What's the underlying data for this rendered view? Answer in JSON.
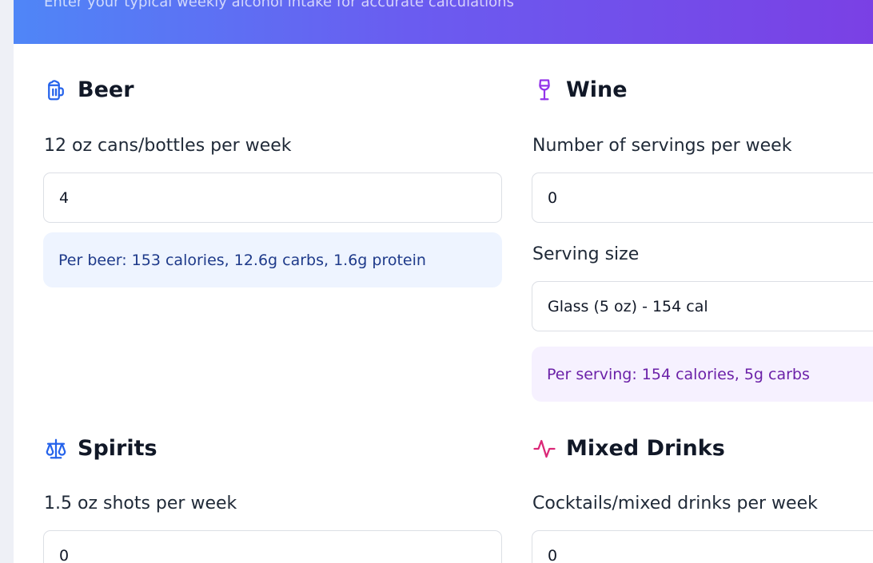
{
  "header": {
    "subtitle": "Enter your typical weekly alcohol intake for accurate calculations"
  },
  "beer": {
    "title": "Beer",
    "icon": "beer-mug-icon",
    "label": "12 oz cans/bottles per week",
    "value": "4",
    "info": "Per beer: 153 calories, 12.6g carbs, 1.6g protein"
  },
  "wine": {
    "title": "Wine",
    "icon": "wine-glass-icon",
    "servings_label": "Number of servings per week",
    "servings_value": "0",
    "size_label": "Serving size",
    "size_value": "Glass (5 oz) - 154 cal",
    "info": "Per serving: 154 calories, 5g carbs"
  },
  "spirits": {
    "title": "Spirits",
    "icon": "scale-icon",
    "label": "1.5 oz shots per week",
    "value": "0"
  },
  "mixed": {
    "title": "Mixed Drinks",
    "icon": "pulse-icon",
    "label": "Cocktails/mixed drinks per week",
    "value": "0"
  },
  "colors": {
    "header_gradient_start": "#4f86f7",
    "header_gradient_end": "#7b3fe4",
    "beer_icon": "#2563eb",
    "wine_icon": "#9333ea",
    "spirits_icon": "#2563eb",
    "mixed_icon": "#db2777",
    "beer_info_bg": "#eef4ff",
    "wine_info_bg": "#f6f1ff"
  }
}
